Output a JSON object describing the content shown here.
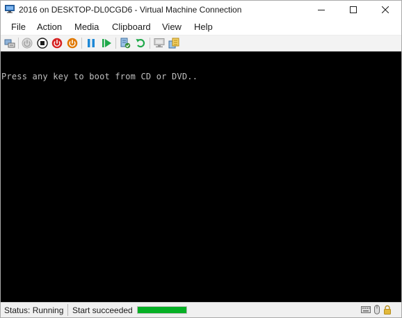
{
  "window": {
    "title": "2016 on DESKTOP-DL0CGD6 - Virtual Machine Connection",
    "controls": {
      "minimize": "minimize",
      "maximize": "maximize",
      "close": "close"
    }
  },
  "menu": {
    "items": [
      {
        "label": "File"
      },
      {
        "label": "Action"
      },
      {
        "label": "Media"
      },
      {
        "label": "Clipboard"
      },
      {
        "label": "View"
      },
      {
        "label": "Help"
      }
    ]
  },
  "toolbar": {
    "buttons": [
      {
        "icon": "ctrl-alt-del-icon",
        "state": "enabled"
      },
      {
        "icon": "start-icon",
        "state": "disabled"
      },
      {
        "icon": "turn-off-icon",
        "color": "#1a1a1a"
      },
      {
        "icon": "shut-down-icon",
        "color": "#d62222"
      },
      {
        "icon": "save-icon",
        "color": "#e07800"
      },
      {
        "icon": "pause-icon",
        "color": "#1e88d6"
      },
      {
        "icon": "reset-icon",
        "color": "#1fa94a"
      },
      {
        "icon": "checkpoint-icon",
        "color": "#3a8f3a"
      },
      {
        "icon": "revert-icon",
        "color": "#1fa94a"
      },
      {
        "icon": "enhanced-session-icon",
        "state": "disabled"
      },
      {
        "icon": "share-icon",
        "color": "#d4a020"
      }
    ]
  },
  "console": {
    "text": "Press any key to boot from CD or DVD..",
    "text_color": "#c0c0c0",
    "background": "#000000"
  },
  "status": {
    "label": "Status: Running",
    "message": "Start succeeded",
    "progress_percent": 100,
    "progress_color": "#06b025",
    "icons": [
      "keyboard-icon",
      "mouse-icon",
      "lock-icon"
    ]
  }
}
